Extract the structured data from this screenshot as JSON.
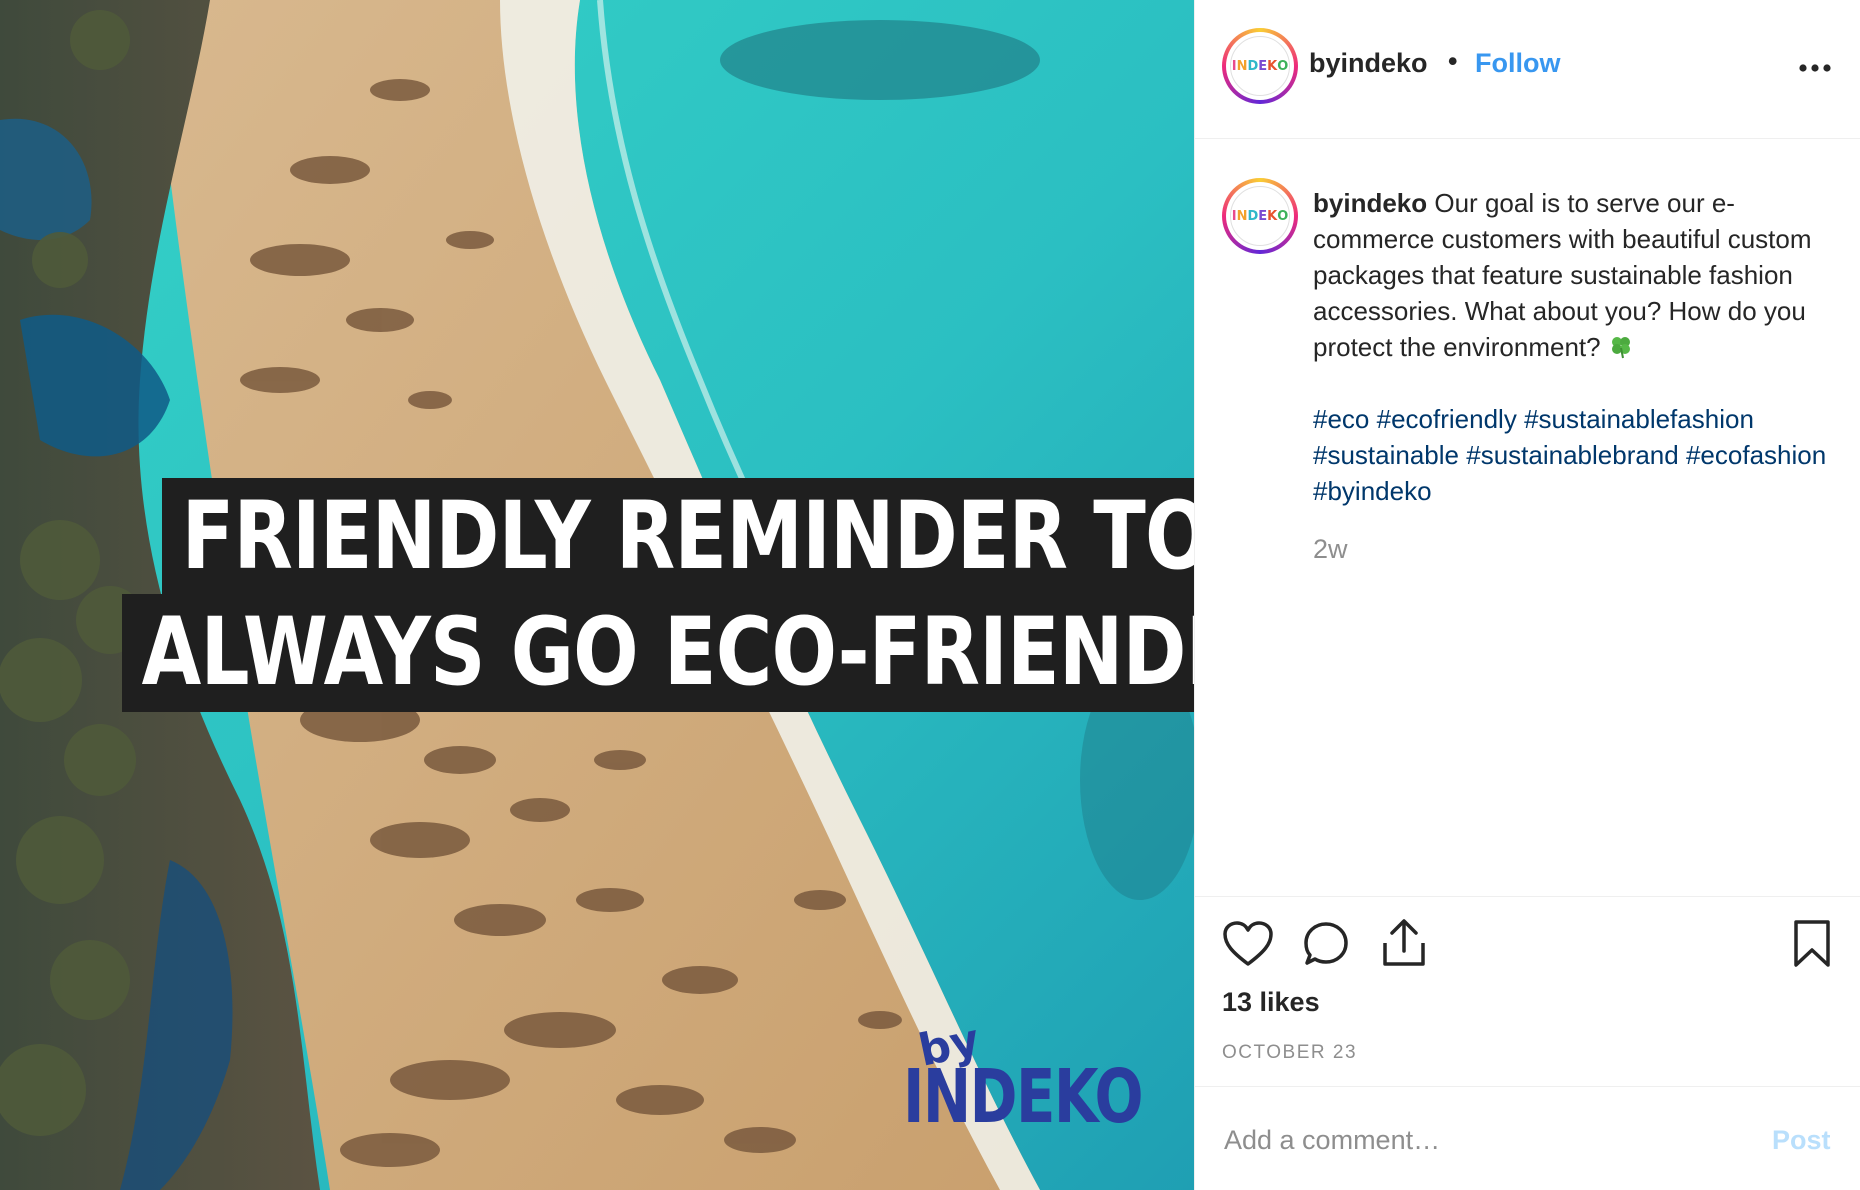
{
  "post": {
    "image": {
      "headline_line1": "FRIENDLY REMINDER TO",
      "headline_line2": "ALWAYS GO ECO-FRIENDLY",
      "brand_by": "by",
      "brand_name": "INDEKO"
    },
    "header": {
      "username": "byindeko",
      "separator": "•",
      "follow_label": "Follow",
      "more_icon": "more-horizontal-icon"
    },
    "avatar_text": "INDEKO",
    "caption": {
      "username": "byindeko",
      "text": "Our goal is to serve our e-commerce customers with beautiful custom packages that feature sustainable fashion accessories. What about you? How do you protect the environment?",
      "emoji_icon": "four-leaf-clover-icon",
      "hashtags": [
        "#eco",
        "#ecofriendly",
        "#sustainablefashion",
        "#sustainable",
        "#sustainablebrand",
        "#ecofashion",
        "#byindeko"
      ],
      "time_ago": "2w"
    },
    "actions": {
      "icons": [
        "heart-icon",
        "comment-icon",
        "share-icon",
        "bookmark-icon"
      ],
      "likes": "13 likes",
      "date": "OCTOBER 23"
    },
    "comment": {
      "placeholder": "Add a comment…",
      "post_label": "Post"
    },
    "colors": {
      "link_blue": "#3897f0",
      "hashtag": "#00376b",
      "post_disabled": "#b9dffc",
      "muted": "#8e8e8e",
      "brand_navy": "#2a3d9e"
    }
  }
}
